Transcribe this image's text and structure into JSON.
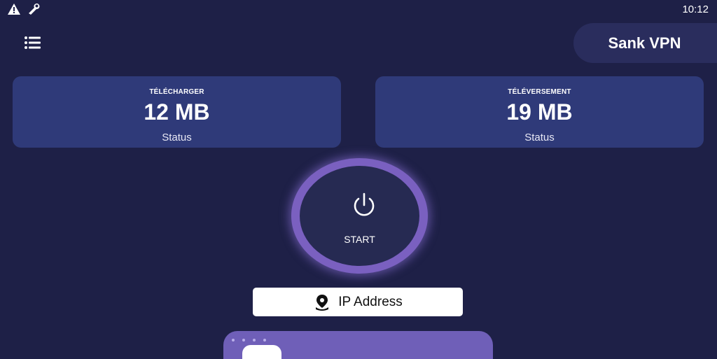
{
  "status_bar": {
    "time": "10:12",
    "icons": [
      "warning-icon",
      "wrench-icon"
    ]
  },
  "header": {
    "menu_icon": "list-icon",
    "brand": "Sank VPN"
  },
  "stats": [
    {
      "label": "TÉLÉCHARGER",
      "value": "12 MB",
      "status": "Status"
    },
    {
      "label": "TÉLÉVERSEMENT",
      "value": "19 MB",
      "status": "Status"
    }
  ],
  "power": {
    "label": "START",
    "icon": "power-icon"
  },
  "ip": {
    "icon": "location-pin-icon",
    "label": "IP Address"
  },
  "colors": {
    "background": "#1e2047",
    "card": "#2f3a79",
    "accent": "#7a60c0",
    "pill": "#2a2d5d"
  }
}
